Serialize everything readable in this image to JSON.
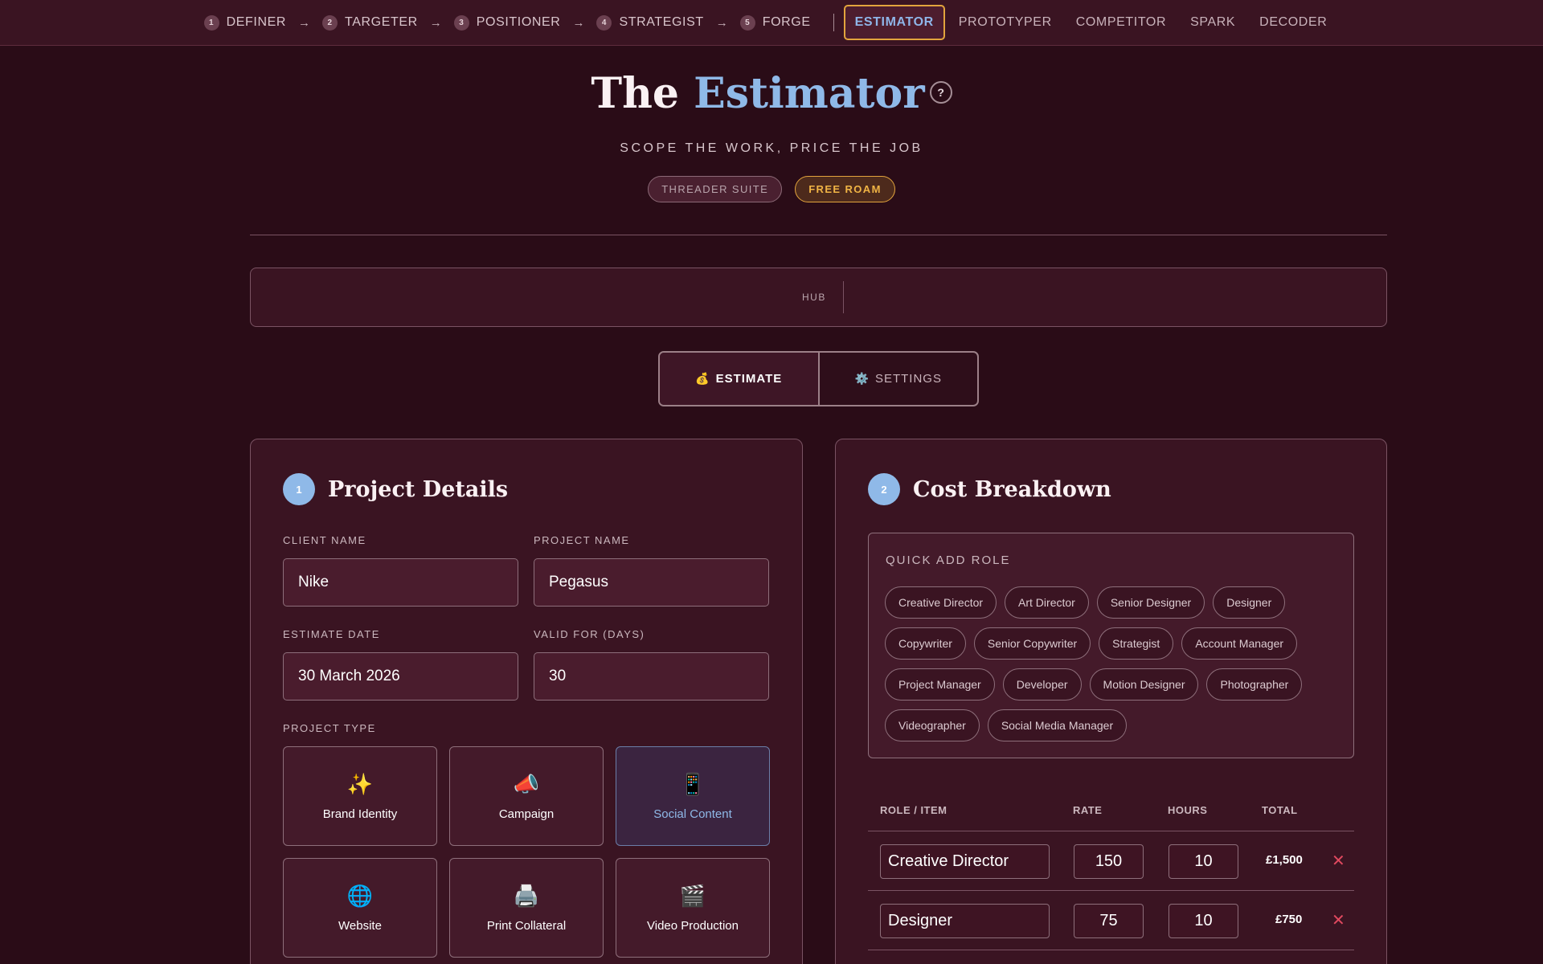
{
  "nav": {
    "steps": [
      {
        "num": "1",
        "label": "DEFINER"
      },
      {
        "num": "2",
        "label": "TARGETER"
      },
      {
        "num": "3",
        "label": "POSITIONER"
      },
      {
        "num": "4",
        "label": "STRATEGIST"
      },
      {
        "num": "5",
        "label": "FORGE"
      }
    ],
    "arrow": "→",
    "active": "ESTIMATOR",
    "links": [
      "PROTOTYPER",
      "COMPETITOR",
      "SPARK",
      "DECODER"
    ]
  },
  "hero": {
    "title_plain": "The ",
    "title_accent": "Estimator",
    "help": "?",
    "subtitle": "SCOPE THE WORK, PRICE THE JOB",
    "pill_suite": "THREADER SUITE",
    "pill_roam": "FREE ROAM"
  },
  "hub": {
    "label": "HUB"
  },
  "tabs": [
    {
      "icon": "💰",
      "label": "ESTIMATE"
    },
    {
      "icon": "⚙️",
      "label": "SETTINGS"
    }
  ],
  "project": {
    "step": "1",
    "title": "Project Details",
    "client_label": "CLIENT NAME",
    "client_value": "Nike",
    "project_label": "PROJECT NAME",
    "project_value": "Pegasus",
    "date_label": "ESTIMATE DATE",
    "date_value": "30 March 2026",
    "valid_label": "VALID FOR (DAYS)",
    "valid_value": "30",
    "type_label": "PROJECT TYPE",
    "types": [
      {
        "icon": "✨",
        "label": "Brand Identity"
      },
      {
        "icon": "📣",
        "label": "Campaign"
      },
      {
        "icon": "📱",
        "label": "Social Content"
      },
      {
        "icon": "🌐",
        "label": "Website"
      },
      {
        "icon": "🖨️",
        "label": "Print Collateral"
      },
      {
        "icon": "🎬",
        "label": "Video Production"
      }
    ],
    "selected_type": "Social Content"
  },
  "costs": {
    "step": "2",
    "title": "Cost Breakdown",
    "quick_add_label": "QUICK ADD ROLE",
    "roles": [
      "Creative Director",
      "Art Director",
      "Senior Designer",
      "Designer",
      "Copywriter",
      "Senior Copywriter",
      "Strategist",
      "Account Manager",
      "Project Manager",
      "Developer",
      "Motion Designer",
      "Photographer",
      "Videographer",
      "Social Media Manager"
    ],
    "headers": {
      "role": "ROLE / ITEM",
      "rate": "RATE",
      "hours": "HOURS",
      "total": "TOTAL"
    },
    "rows": [
      {
        "role": "Creative Director",
        "rate": "150",
        "hours": "10",
        "total": "£1,500",
        "delete": "✕"
      },
      {
        "role": "Designer",
        "rate": "75",
        "hours": "10",
        "total": "£750",
        "delete": "✕"
      }
    ]
  },
  "colors": {
    "background": "#2a0c17",
    "accent_blue": "#8fb9e8",
    "accent_gold": "#e3a43d",
    "delete_red": "#e0495f"
  }
}
